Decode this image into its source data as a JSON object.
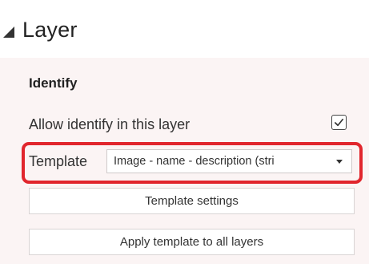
{
  "header": {
    "title": "Layer",
    "toggle_icon": "collapse-triangle-icon"
  },
  "identify": {
    "section_title": "Identify",
    "allow_label": "Allow identify in this layer",
    "allow_checked": true,
    "template_label": "Template",
    "template_value": "Image - name - description (stri",
    "template_settings_label": "Template settings",
    "apply_all_label": "Apply template to all layers"
  },
  "colors": {
    "highlight": "#e1262d",
    "panel_background": "#fbf4f4"
  }
}
